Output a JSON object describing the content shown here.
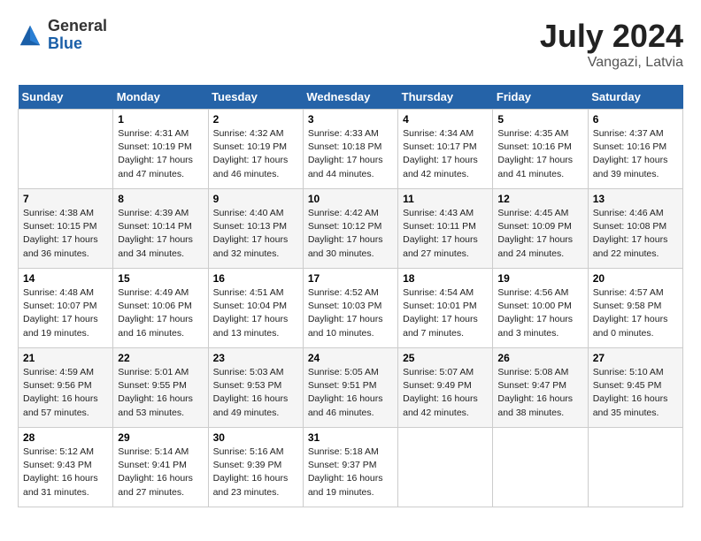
{
  "header": {
    "logo_general": "General",
    "logo_blue": "Blue",
    "month_year": "July 2024",
    "location": "Vangazi, Latvia"
  },
  "columns": [
    "Sunday",
    "Monday",
    "Tuesday",
    "Wednesday",
    "Thursday",
    "Friday",
    "Saturday"
  ],
  "weeks": [
    [
      {
        "day": "",
        "text": ""
      },
      {
        "day": "1",
        "text": "Sunrise: 4:31 AM\nSunset: 10:19 PM\nDaylight: 17 hours\nand 47 minutes."
      },
      {
        "day": "2",
        "text": "Sunrise: 4:32 AM\nSunset: 10:19 PM\nDaylight: 17 hours\nand 46 minutes."
      },
      {
        "day": "3",
        "text": "Sunrise: 4:33 AM\nSunset: 10:18 PM\nDaylight: 17 hours\nand 44 minutes."
      },
      {
        "day": "4",
        "text": "Sunrise: 4:34 AM\nSunset: 10:17 PM\nDaylight: 17 hours\nand 42 minutes."
      },
      {
        "day": "5",
        "text": "Sunrise: 4:35 AM\nSunset: 10:16 PM\nDaylight: 17 hours\nand 41 minutes."
      },
      {
        "day": "6",
        "text": "Sunrise: 4:37 AM\nSunset: 10:16 PM\nDaylight: 17 hours\nand 39 minutes."
      }
    ],
    [
      {
        "day": "7",
        "text": "Sunrise: 4:38 AM\nSunset: 10:15 PM\nDaylight: 17 hours\nand 36 minutes."
      },
      {
        "day": "8",
        "text": "Sunrise: 4:39 AM\nSunset: 10:14 PM\nDaylight: 17 hours\nand 34 minutes."
      },
      {
        "day": "9",
        "text": "Sunrise: 4:40 AM\nSunset: 10:13 PM\nDaylight: 17 hours\nand 32 minutes."
      },
      {
        "day": "10",
        "text": "Sunrise: 4:42 AM\nSunset: 10:12 PM\nDaylight: 17 hours\nand 30 minutes."
      },
      {
        "day": "11",
        "text": "Sunrise: 4:43 AM\nSunset: 10:11 PM\nDaylight: 17 hours\nand 27 minutes."
      },
      {
        "day": "12",
        "text": "Sunrise: 4:45 AM\nSunset: 10:09 PM\nDaylight: 17 hours\nand 24 minutes."
      },
      {
        "day": "13",
        "text": "Sunrise: 4:46 AM\nSunset: 10:08 PM\nDaylight: 17 hours\nand 22 minutes."
      }
    ],
    [
      {
        "day": "14",
        "text": "Sunrise: 4:48 AM\nSunset: 10:07 PM\nDaylight: 17 hours\nand 19 minutes."
      },
      {
        "day": "15",
        "text": "Sunrise: 4:49 AM\nSunset: 10:06 PM\nDaylight: 17 hours\nand 16 minutes."
      },
      {
        "day": "16",
        "text": "Sunrise: 4:51 AM\nSunset: 10:04 PM\nDaylight: 17 hours\nand 13 minutes."
      },
      {
        "day": "17",
        "text": "Sunrise: 4:52 AM\nSunset: 10:03 PM\nDaylight: 17 hours\nand 10 minutes."
      },
      {
        "day": "18",
        "text": "Sunrise: 4:54 AM\nSunset: 10:01 PM\nDaylight: 17 hours\nand 7 minutes."
      },
      {
        "day": "19",
        "text": "Sunrise: 4:56 AM\nSunset: 10:00 PM\nDaylight: 17 hours\nand 3 minutes."
      },
      {
        "day": "20",
        "text": "Sunrise: 4:57 AM\nSunset: 9:58 PM\nDaylight: 17 hours\nand 0 minutes."
      }
    ],
    [
      {
        "day": "21",
        "text": "Sunrise: 4:59 AM\nSunset: 9:56 PM\nDaylight: 16 hours\nand 57 minutes."
      },
      {
        "day": "22",
        "text": "Sunrise: 5:01 AM\nSunset: 9:55 PM\nDaylight: 16 hours\nand 53 minutes."
      },
      {
        "day": "23",
        "text": "Sunrise: 5:03 AM\nSunset: 9:53 PM\nDaylight: 16 hours\nand 49 minutes."
      },
      {
        "day": "24",
        "text": "Sunrise: 5:05 AM\nSunset: 9:51 PM\nDaylight: 16 hours\nand 46 minutes."
      },
      {
        "day": "25",
        "text": "Sunrise: 5:07 AM\nSunset: 9:49 PM\nDaylight: 16 hours\nand 42 minutes."
      },
      {
        "day": "26",
        "text": "Sunrise: 5:08 AM\nSunset: 9:47 PM\nDaylight: 16 hours\nand 38 minutes."
      },
      {
        "day": "27",
        "text": "Sunrise: 5:10 AM\nSunset: 9:45 PM\nDaylight: 16 hours\nand 35 minutes."
      }
    ],
    [
      {
        "day": "28",
        "text": "Sunrise: 5:12 AM\nSunset: 9:43 PM\nDaylight: 16 hours\nand 31 minutes."
      },
      {
        "day": "29",
        "text": "Sunrise: 5:14 AM\nSunset: 9:41 PM\nDaylight: 16 hours\nand 27 minutes."
      },
      {
        "day": "30",
        "text": "Sunrise: 5:16 AM\nSunset: 9:39 PM\nDaylight: 16 hours\nand 23 minutes."
      },
      {
        "day": "31",
        "text": "Sunrise: 5:18 AM\nSunset: 9:37 PM\nDaylight: 16 hours\nand 19 minutes."
      },
      {
        "day": "",
        "text": ""
      },
      {
        "day": "",
        "text": ""
      },
      {
        "day": "",
        "text": ""
      }
    ]
  ]
}
